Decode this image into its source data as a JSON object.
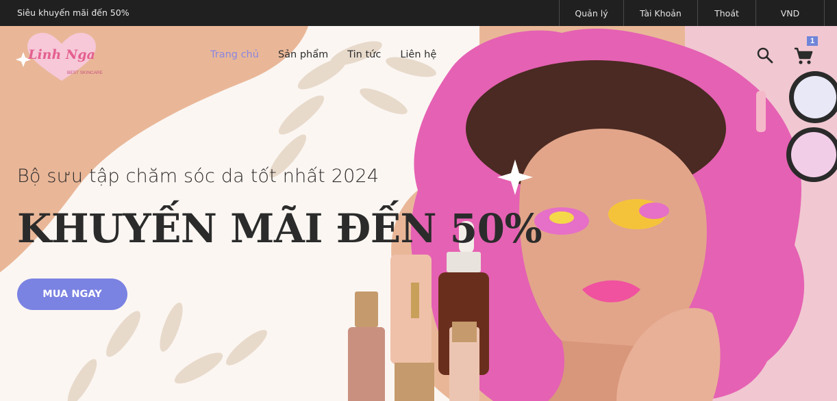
{
  "topbar": {
    "promo_text": "Siêu khuyến mãi đến 50%",
    "links": [
      "Quản lý",
      "Tài Khoản",
      "Thoát",
      "VND"
    ]
  },
  "logo": {
    "brand": "Linh Nga",
    "tagline": "BEST SKINCARE"
  },
  "nav": {
    "items": [
      "Trang chủ",
      "Sản phẩm",
      "Tin tức",
      "Liên hệ"
    ],
    "active": "Trang chủ"
  },
  "header_icons": [
    "search-icon",
    "cart-icon"
  ],
  "cart": {
    "count": "1"
  },
  "hero": {
    "subtitle": "Bộ sưu tập chăm sóc da tốt nhất 2024",
    "headline": "KHUYẾN MÃI ĐẾN 50%",
    "cta_label": "MUA NGAY"
  },
  "colors": {
    "topbar_bg": "#202020",
    "hero_peach": "#e9b798",
    "hero_pink": "#e561b3",
    "accent": "#7a82e2",
    "active_nav": "#8a86e0"
  }
}
